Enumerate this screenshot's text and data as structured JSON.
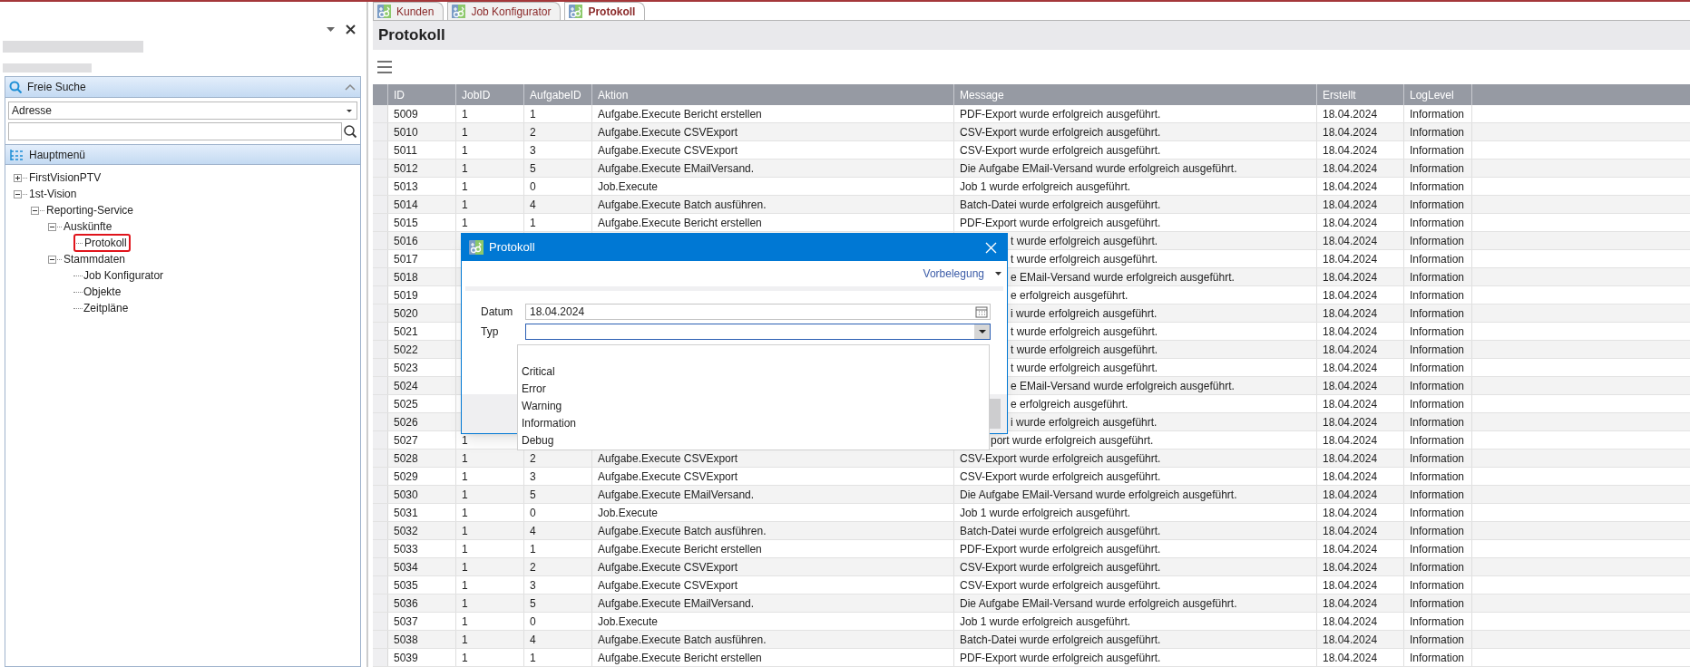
{
  "sidebar": {
    "search_panel": {
      "title": "Freie Suche",
      "field_select": "Adresse"
    },
    "menu_panel": {
      "title": "Hauptmenü",
      "tree": [
        {
          "label": "FirstVisionPTV",
          "expanded": false,
          "selected": false
        },
        {
          "label": "1st-Vision",
          "expanded": true,
          "selected": false,
          "children": [
            {
              "label": "Reporting-Service",
              "expanded": true,
              "selected": false,
              "children": [
                {
                  "label": "Auskünfte",
                  "expanded": true,
                  "selected": false,
                  "children": [
                    {
                      "label": "Protokoll",
                      "selected": true
                    }
                  ]
                },
                {
                  "label": "Stammdaten",
                  "expanded": true,
                  "selected": false,
                  "children": [
                    {
                      "label": "Job Konfigurator",
                      "selected": false
                    },
                    {
                      "label": "Objekte",
                      "selected": false
                    },
                    {
                      "label": "Zeitpläne",
                      "selected": false
                    }
                  ]
                }
              ]
            }
          ]
        }
      ]
    }
  },
  "tabs": [
    {
      "label": "Kunden",
      "selected": false
    },
    {
      "label": "Job Konfigurator",
      "selected": false
    },
    {
      "label": "Protokoll",
      "selected": true
    }
  ],
  "page": {
    "title": "Protokoll"
  },
  "table": {
    "columns": [
      "ID",
      "JobID",
      "AufgabeID",
      "Aktion",
      "Message",
      "Erstellt",
      "LogLevel"
    ],
    "rows": [
      {
        "kind": "full",
        "id": "5009",
        "job_id": "1",
        "task_id": "1",
        "action": "Aufgabe.Execute Bericht erstellen",
        "message": "PDF-Export wurde erfolgreich ausgeführt.",
        "created": "18.04.2024",
        "log_level": "Information"
      },
      {
        "kind": "full",
        "id": "5010",
        "job_id": "1",
        "task_id": "2",
        "action": "Aufgabe.Execute CSVExport",
        "message": "CSV-Export wurde erfolgreich ausgeführt.",
        "created": "18.04.2024",
        "log_level": "Information"
      },
      {
        "kind": "full",
        "id": "5011",
        "job_id": "1",
        "task_id": "3",
        "action": "Aufgabe.Execute CSVExport",
        "message": "CSV-Export wurde erfolgreich ausgeführt.",
        "created": "18.04.2024",
        "log_level": "Information"
      },
      {
        "kind": "full",
        "id": "5012",
        "job_id": "1",
        "task_id": "5",
        "action": "Aufgabe.Execute EMailVersand.",
        "message": "Die Aufgabe EMail-Versand wurde erfolgreich ausgeführt.",
        "created": "18.04.2024",
        "log_level": "Information"
      },
      {
        "kind": "full",
        "id": "5013",
        "job_id": "1",
        "task_id": "0",
        "action": "Job.Execute",
        "message": "Job 1 wurde erfolgreich ausgeführt.",
        "created": "18.04.2024",
        "log_level": "Information"
      },
      {
        "kind": "full",
        "id": "5014",
        "job_id": "1",
        "task_id": "4",
        "action": "Aufgabe.Execute Batch ausführen.",
        "message": "Batch-Datei wurde erfolgreich ausgeführt.",
        "created": "18.04.2024",
        "log_level": "Information"
      },
      {
        "kind": "full",
        "id": "5015",
        "job_id": "1",
        "task_id": "1",
        "action": "Aufgabe.Execute Bericht erstellen",
        "message": "PDF-Export wurde erfolgreich ausgeführt.",
        "created": "18.04.2024",
        "log_level": "Information"
      },
      {
        "kind": "under_dialog",
        "id": "5016",
        "message": "t wurde erfolgreich ausgeführt.",
        "created": "18.04.2024",
        "log_level": "Information"
      },
      {
        "kind": "under_dialog",
        "id": "5017",
        "message": "t wurde erfolgreich ausgeführt.",
        "created": "18.04.2024",
        "log_level": "Information"
      },
      {
        "kind": "under_dialog",
        "id": "5018",
        "message": "e EMail-Versand wurde erfolgreich ausgeführt.",
        "created": "18.04.2024",
        "log_level": "Information"
      },
      {
        "kind": "under_dialog",
        "id": "5019",
        "message": "e erfolgreich ausgeführt.",
        "created": "18.04.2024",
        "log_level": "Information"
      },
      {
        "kind": "under_dialog",
        "id": "5020",
        "message": "i wurde erfolgreich ausgeführt.",
        "created": "18.04.2024",
        "log_level": "Information"
      },
      {
        "kind": "under_dialog",
        "id": "5021",
        "message": "t wurde erfolgreich ausgeführt.",
        "created": "18.04.2024",
        "log_level": "Information"
      },
      {
        "kind": "under_dialog",
        "id": "5022",
        "message": "t wurde erfolgreich ausgeführt.",
        "created": "18.04.2024",
        "log_level": "Information"
      },
      {
        "kind": "under_dialog",
        "id": "5023",
        "message": "t wurde erfolgreich ausgeführt.",
        "created": "18.04.2024",
        "log_level": "Information"
      },
      {
        "kind": "under_dialog",
        "id": "5024",
        "message": "e EMail-Versand wurde erfolgreich ausgeführt.",
        "created": "18.04.2024",
        "log_level": "Information"
      },
      {
        "kind": "under_dialog",
        "id": "5025",
        "message": "e erfolgreich ausgeführt.",
        "created": "18.04.2024",
        "log_level": "Information"
      },
      {
        "kind": "under_dialog",
        "id": "5026",
        "message": "i wurde erfolgreich ausgeführt.",
        "created": "18.04.2024",
        "log_level": "Information"
      },
      {
        "kind": "under_list",
        "id": "5027",
        "job_id": "1",
        "message": "port wurde erfolgreich ausgeführt.",
        "created": "18.04.2024",
        "log_level": "Information"
      },
      {
        "kind": "full",
        "id": "5028",
        "job_id": "1",
        "task_id": "2",
        "action": "Aufgabe.Execute CSVExport",
        "message": "CSV-Export wurde erfolgreich ausgeführt.",
        "created": "18.04.2024",
        "log_level": "Information"
      },
      {
        "kind": "full",
        "id": "5029",
        "job_id": "1",
        "task_id": "3",
        "action": "Aufgabe.Execute CSVExport",
        "message": "CSV-Export wurde erfolgreich ausgeführt.",
        "created": "18.04.2024",
        "log_level": "Information"
      },
      {
        "kind": "full",
        "id": "5030",
        "job_id": "1",
        "task_id": "5",
        "action": "Aufgabe.Execute EMailVersand.",
        "message": "Die Aufgabe EMail-Versand wurde erfolgreich ausgeführt.",
        "created": "18.04.2024",
        "log_level": "Information"
      },
      {
        "kind": "full",
        "id": "5031",
        "job_id": "1",
        "task_id": "0",
        "action": "Job.Execute",
        "message": "Job 1 wurde erfolgreich ausgeführt.",
        "created": "18.04.2024",
        "log_level": "Information"
      },
      {
        "kind": "full",
        "id": "5032",
        "job_id": "1",
        "task_id": "4",
        "action": "Aufgabe.Execute Batch ausführen.",
        "message": "Batch-Datei wurde erfolgreich ausgeführt.",
        "created": "18.04.2024",
        "log_level": "Information"
      },
      {
        "kind": "full",
        "id": "5033",
        "job_id": "1",
        "task_id": "1",
        "action": "Aufgabe.Execute Bericht erstellen",
        "message": "PDF-Export wurde erfolgreich ausgeführt.",
        "created": "18.04.2024",
        "log_level": "Information"
      },
      {
        "kind": "full",
        "id": "5034",
        "job_id": "1",
        "task_id": "2",
        "action": "Aufgabe.Execute CSVExport",
        "message": "CSV-Export wurde erfolgreich ausgeführt.",
        "created": "18.04.2024",
        "log_level": "Information"
      },
      {
        "kind": "full",
        "id": "5035",
        "job_id": "1",
        "task_id": "3",
        "action": "Aufgabe.Execute CSVExport",
        "message": "CSV-Export wurde erfolgreich ausgeführt.",
        "created": "18.04.2024",
        "log_level": "Information"
      },
      {
        "kind": "full",
        "id": "5036",
        "job_id": "1",
        "task_id": "5",
        "action": "Aufgabe.Execute EMailVersand.",
        "message": "Die Aufgabe EMail-Versand wurde erfolgreich ausgeführt.",
        "created": "18.04.2024",
        "log_level": "Information"
      },
      {
        "kind": "full",
        "id": "5037",
        "job_id": "1",
        "task_id": "0",
        "action": "Job.Execute",
        "message": "Job 1 wurde erfolgreich ausgeführt.",
        "created": "18.04.2024",
        "log_level": "Information"
      },
      {
        "kind": "full",
        "id": "5038",
        "job_id": "1",
        "task_id": "4",
        "action": "Aufgabe.Execute Batch ausführen.",
        "message": "Batch-Datei wurde erfolgreich ausgeführt.",
        "created": "18.04.2024",
        "log_level": "Information"
      },
      {
        "kind": "full",
        "id": "5039",
        "job_id": "1",
        "task_id": "1",
        "action": "Aufgabe.Execute Bericht erstellen",
        "message": "PDF-Export wurde erfolgreich ausgeführt.",
        "created": "18.04.2024",
        "log_level": "Information"
      }
    ]
  },
  "dialog": {
    "title": "Protokoll",
    "preset_link": "Vorbelegung",
    "fields": [
      {
        "kind": "date",
        "label": "Datum",
        "value": "18.04.2024",
        "focused": false
      },
      {
        "kind": "select",
        "label": "Typ",
        "focused": true,
        "open": true,
        "options": [
          "Critical",
          "Error",
          "Warning",
          "Information",
          "Debug"
        ]
      }
    ]
  }
}
